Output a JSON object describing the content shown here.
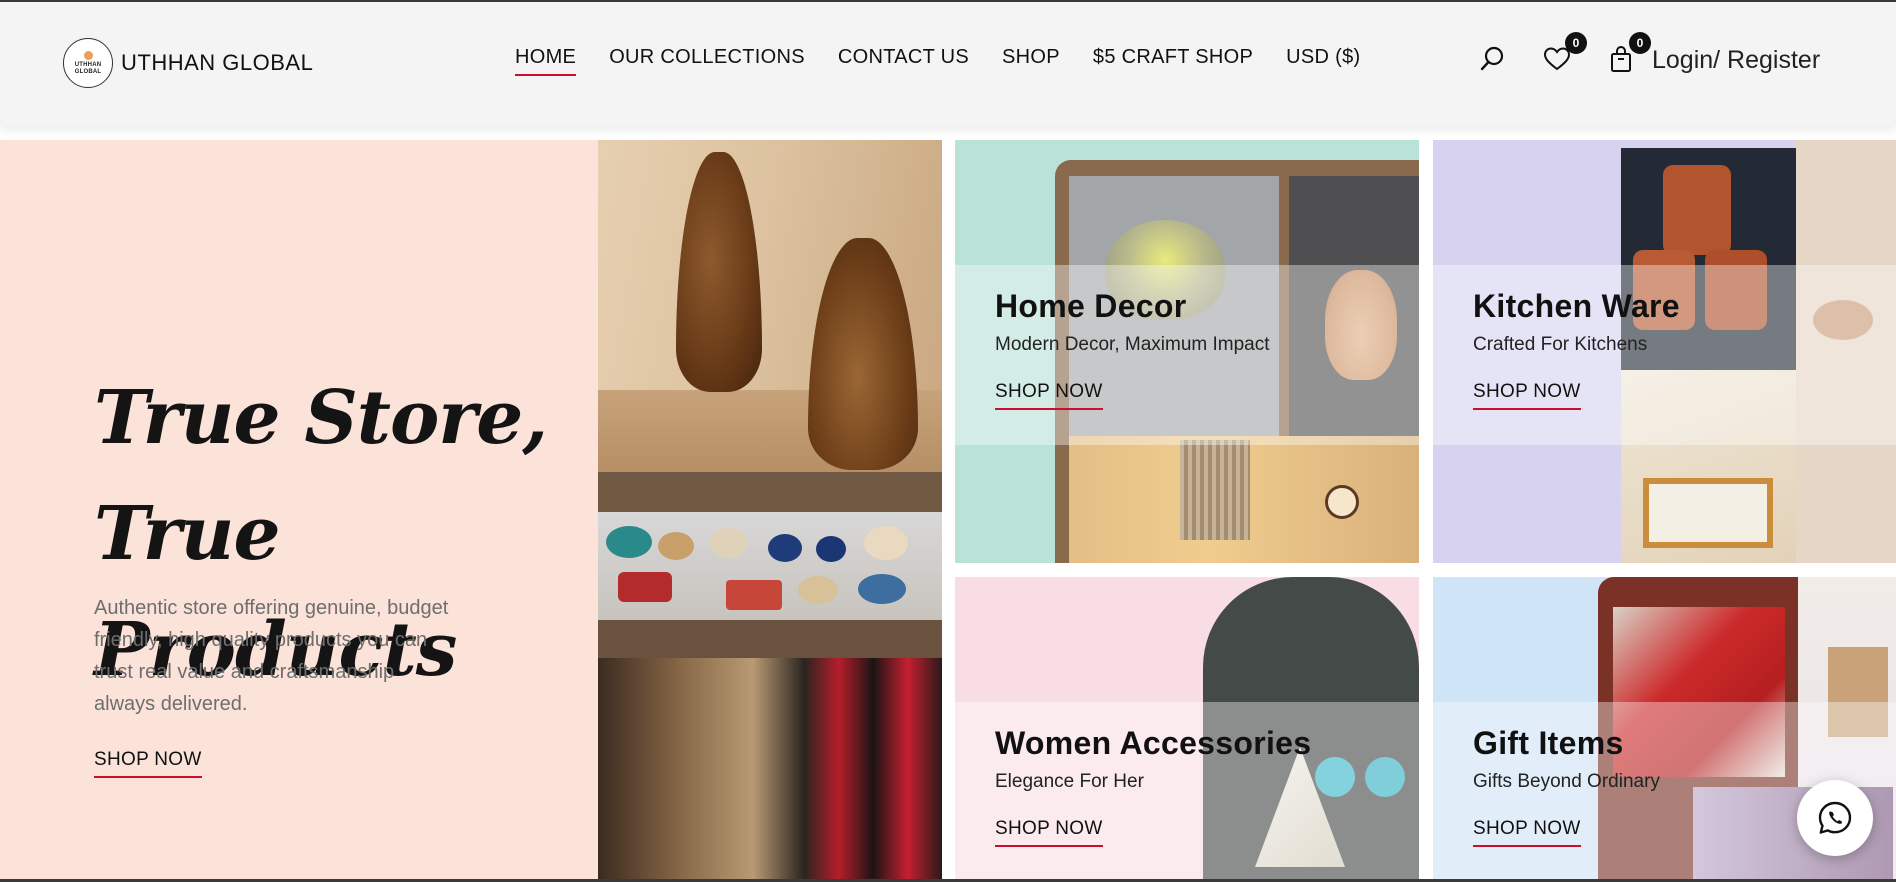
{
  "brand": {
    "name": "UTHHAN GLOBAL",
    "logo_text_line1": "UTHHAN",
    "logo_text_line2": "GLOBAL"
  },
  "nav": {
    "items": [
      {
        "label": "HOME",
        "active": true
      },
      {
        "label": "OUR COLLECTIONS",
        "active": false
      },
      {
        "label": "CONTACT US",
        "active": false
      },
      {
        "label": "SHOP",
        "active": false
      },
      {
        "label": "$5 CRAFT SHOP",
        "active": false
      },
      {
        "label": "USD ($)",
        "active": false
      }
    ]
  },
  "header_icons": {
    "search": "search-icon",
    "wishlist": {
      "icon": "heart-icon",
      "count": "0"
    },
    "cart": {
      "icon": "shopping-bag-icon",
      "count": "0"
    },
    "login_label": "Login/ Register"
  },
  "hero": {
    "title": "True Store, True Products",
    "description": "Authentic store offering genuine, budget friendly, high quality products you can trust real value and craftsmanship always delivered.",
    "cta": "SHOP NOW"
  },
  "categories": [
    {
      "title": "Home Decor",
      "subtitle": "Modern Decor, Maximum Impact",
      "cta": "SHOP NOW",
      "bg": "#b9e3d7"
    },
    {
      "title": "Kitchen Ware",
      "subtitle": "Crafted For Kitchens",
      "cta": "SHOP NOW",
      "bg": "#d6d2f0"
    },
    {
      "title": "Women Accessories",
      "subtitle": "Elegance For Her",
      "cta": "SHOP NOW",
      "bg": "#f9dde4"
    },
    {
      "title": "Gift Items",
      "subtitle": "Gifts Beyond Ordinary",
      "cta": "SHOP NOW",
      "bg": "#cfe4f6"
    }
  ],
  "floating": {
    "whatsapp": "whatsapp-icon"
  },
  "colors": {
    "accent_underline": "#c8102e",
    "hero_bg": "#fbe3d9",
    "header_bg": "#f4f4f4"
  }
}
